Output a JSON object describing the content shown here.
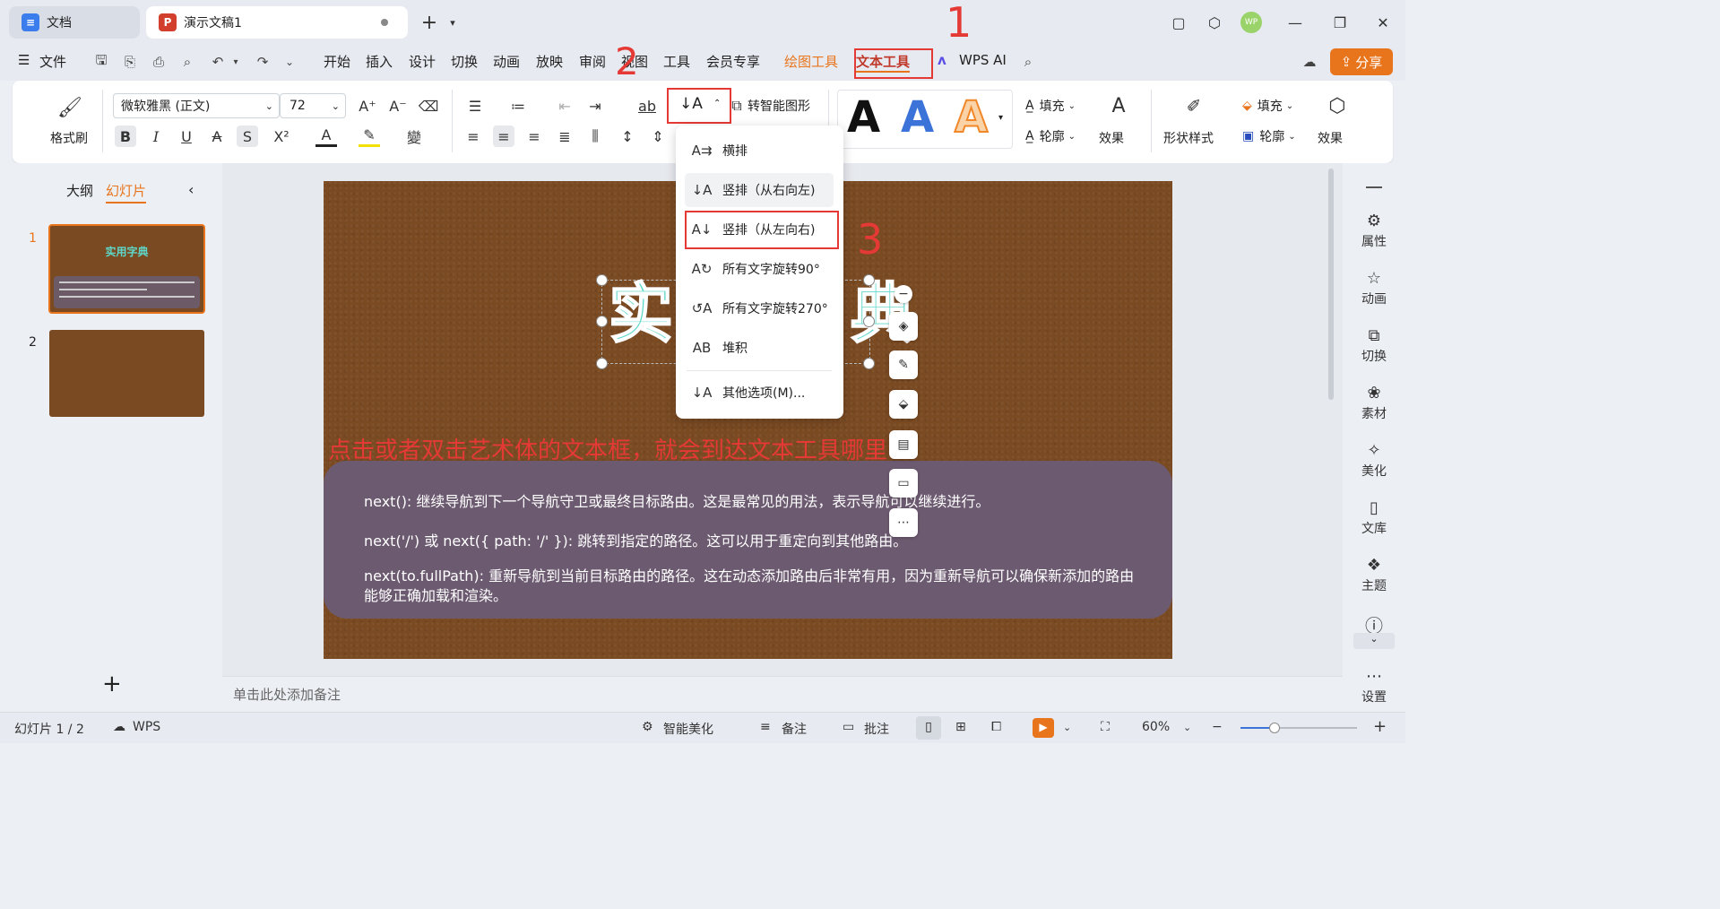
{
  "tabs": {
    "doc": "文档",
    "ppt": "演示文稿1",
    "ppt_icon": "P",
    "doc_icon_color": "#3b7ded",
    "ppt_icon_color": "#d2402d"
  },
  "avatar": "WP",
  "menu": {
    "file": "文件",
    "items": [
      "开始",
      "插入",
      "设计",
      "切换",
      "动画",
      "放映",
      "审阅",
      "视图",
      "工具",
      "会员专享"
    ],
    "drawing_tools": "绘图工具",
    "text_tools": "文本工具",
    "wps_ai": "WPS AI",
    "share": "分享"
  },
  "ribbon": {
    "format_painter": "格式刷",
    "font_name": "微软雅黑 (正文)",
    "font_size": "72",
    "smart_shape": "转智能图形",
    "fill": "填充",
    "outline": "轮廓",
    "effect": "效果",
    "shape_style": "形状样式",
    "fill2": "填充",
    "outline2": "轮廓",
    "effect2": "效果",
    "text_style_letter": "A"
  },
  "panel": {
    "outline_tab": "大纲",
    "slides_tab": "幻灯片",
    "slide1_num": "1",
    "slide2_num": "2",
    "thumb_title": "实用字典"
  },
  "dropdown": {
    "items": [
      "横排",
      "竖排（从右向左)",
      "竖排（从左向右)",
      "所有文字旋转90°",
      "所有文字旋转270°",
      "堆积",
      "其他选项(M)..."
    ]
  },
  "slide": {
    "title_left": "实",
    "title_right": "典",
    "caption": "点击或者双击艺术体的文本框，就会到达文本工具哪里",
    "para1": "next(): 继续导航到下一个导航守卫或最终目标路由。这是最常见的用法，表示导航可以继续进行。",
    "para2": "next('/') 或 next({ path: '/' }): 跳转到指定的路径。这可以用于重定向到其他路由。",
    "para3": "next(to.fullPath): 重新导航到当前目标路由的路径。这在动态添加路由后非常有用，因为重新导航可以确保新添加的路由能够正确加载和渲染。"
  },
  "annotations": {
    "n1": "1",
    "n2": "2",
    "n3": "3"
  },
  "notes_placeholder": "单击此处添加备注",
  "sidebar": [
    "属性",
    "动画",
    "切换",
    "素材",
    "美化",
    "文库",
    "主题",
    "设置"
  ],
  "status": {
    "slide_count": "幻灯片 1 / 2",
    "wps": "WPS",
    "smart_beautify": "智能美化",
    "notes": "备注",
    "comment": "批注",
    "zoom": "60%"
  },
  "colors": {
    "accent": "#e8741c",
    "annotation_red": "#e53935",
    "slide_bg": "#7a4a22",
    "title_teal": "#5ed7c8"
  }
}
